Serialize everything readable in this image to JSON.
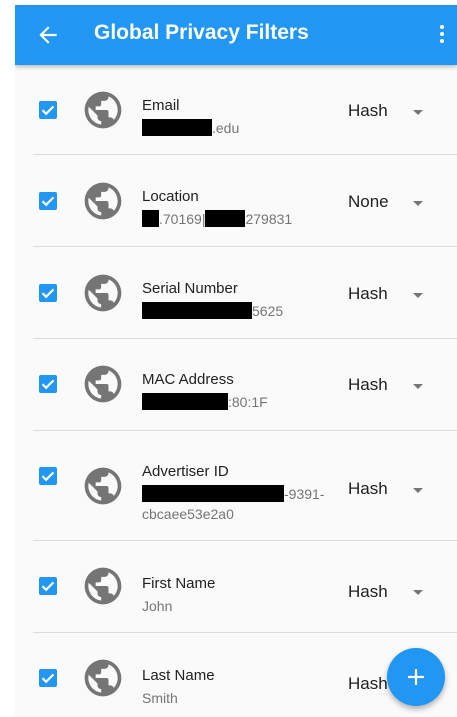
{
  "header": {
    "title": "Global Privacy Filters",
    "back_icon": "arrow-back-icon",
    "menu_icon": "more-vert-icon"
  },
  "filters": [
    {
      "label": "Email",
      "value_visible": ".edu",
      "value_line2": "",
      "checked": true,
      "mode": "Hash"
    },
    {
      "label": "Location",
      "value_visible": ".70169|",
      "value_visible_2": "279831",
      "value_line2": "",
      "checked": true,
      "mode": "None"
    },
    {
      "label": "Serial Number",
      "value_visible": "5625",
      "value_line2": "",
      "checked": true,
      "mode": "Hash"
    },
    {
      "label": "MAC Address",
      "value_visible": ":80:1F",
      "value_line2": "",
      "checked": true,
      "mode": "Hash"
    },
    {
      "label": "Advertiser ID",
      "value_visible": "-9391-",
      "value_line2": "cbcaee53e2a0",
      "checked": true,
      "mode": "Hash"
    },
    {
      "label": "First Name",
      "value_visible": "John",
      "value_line2": "",
      "checked": true,
      "mode": "Hash"
    },
    {
      "label": "Last Name",
      "value_visible": "Smith",
      "value_line2": "",
      "checked": true,
      "mode": "Hash"
    }
  ],
  "fab": {
    "icon": "add-icon"
  },
  "colors": {
    "primary": "#2196f3",
    "globe": "#757575"
  }
}
